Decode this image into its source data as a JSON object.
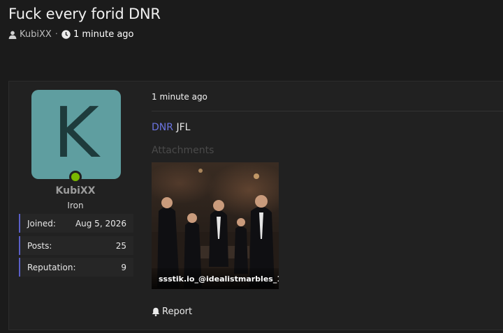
{
  "thread": {
    "title": "Fuck every forid DNR",
    "author": "KubiXX",
    "separator": "·",
    "time": "1 minute ago"
  },
  "user": {
    "avatar_letter": "K",
    "avatar_color": "#5f9ea0",
    "online_color": "#7ab800",
    "username": "KubiXX",
    "rank": "Iron",
    "stats": [
      {
        "label": "Joined:",
        "value": "Aug 5, 2026"
      },
      {
        "label": "Posts:",
        "value": "25"
      },
      {
        "label": "Reputation:",
        "value": "9"
      }
    ]
  },
  "post": {
    "date": "1 minute ago",
    "link_text": "DNR",
    "body_text": "JFL",
    "attachments_label": "Attachments",
    "attachment": {
      "caption": "ssstik.io_@idealistmarbles_1..."
    },
    "report_label": "Report"
  },
  "icons": {
    "author": "user-icon",
    "time": "clock-icon",
    "report": "bell-icon"
  },
  "colors": {
    "accent": "#5b5fc7",
    "link": "#6b74e0"
  }
}
